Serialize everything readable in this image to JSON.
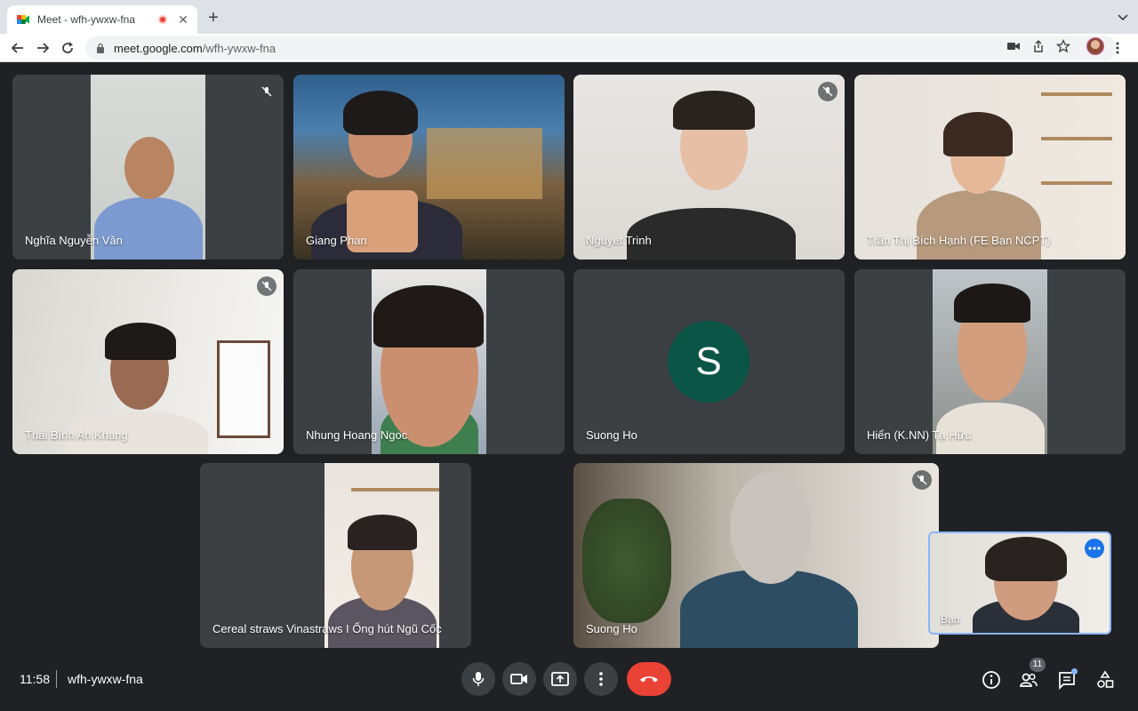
{
  "browser": {
    "tab_title": "Meet - wfh-ywxw-fna",
    "tab_close": "✕",
    "new_tab": "+",
    "url_host": "meet.google.com",
    "url_path": "/wfh-ywxw-fna"
  },
  "participants": [
    {
      "name": "Nghĩa Nguyễn Văn",
      "muted": true
    },
    {
      "name": "Giang Phan",
      "muted": false
    },
    {
      "name": "Nguyet Trinh",
      "muted": true
    },
    {
      "name": "Trần Thị Bích Hạnh (FE Ban NCPT)",
      "muted": false
    },
    {
      "name": "Thái Bình An Khang",
      "muted": true
    },
    {
      "name": "Nhung Hoang Ngoc",
      "muted": false
    },
    {
      "name": "Suong Ho",
      "muted": false,
      "avatar_letter": "S",
      "avatar_color": "#0b5547"
    },
    {
      "name": "Hiển (K.NN) Tạ Hữu",
      "muted": false
    },
    {
      "name": "Cereal straws Vinastraws I Ống hút Ngũ Cốc",
      "muted": false
    },
    {
      "name": "Suong Ho",
      "muted": true
    }
  ],
  "self_view": {
    "label": "Bạn"
  },
  "meeting": {
    "time": "11:58",
    "code": "wfh-ywxw-fna",
    "people_count": "11"
  },
  "controls": [
    "mic",
    "camera",
    "present",
    "more-options",
    "leave-call"
  ],
  "right_controls": [
    "info",
    "people",
    "chat",
    "activities"
  ],
  "colors": {
    "accent": "#8ab4f8",
    "hangup": "#ea4335",
    "background": "#202124",
    "tile": "#3c4043"
  }
}
